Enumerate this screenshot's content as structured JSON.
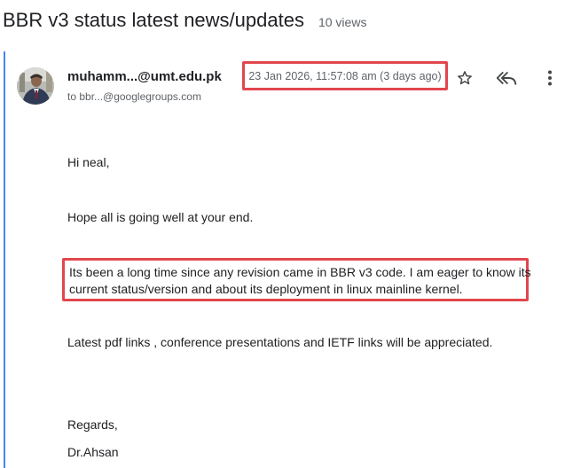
{
  "thread": {
    "title": "BBR v3 status latest news/updates",
    "views": "10 views"
  },
  "message": {
    "sender": "muhamm...@umt.edu.pk",
    "recipient": "to bbr...@googlegroups.com",
    "date": "23 Jan 2026, 11:57:08 am (3 days ago)",
    "actions": {
      "star_icon": "star-outline-icon",
      "reply_all_icon": "reply-all-icon",
      "more_icon": "more-vert-icon"
    },
    "body": {
      "greeting": "Hi neal,",
      "line1": "Hope all is going well at your end.",
      "highlight_line1": "Its been a long time since any revision came in BBR v3 code. I am eager to know its",
      "highlight_line2": "current status/version and about its deployment in linux mainline kernel.",
      "line3": "Latest pdf links , conference presentations and IETF links will be appreciated.",
      "closing": "Regards,",
      "signature": "Dr.Ahsan"
    }
  },
  "colors": {
    "highlight_border": "#e2464d",
    "thread_rule": "#4285f4",
    "secondary_text": "#5f6368"
  }
}
